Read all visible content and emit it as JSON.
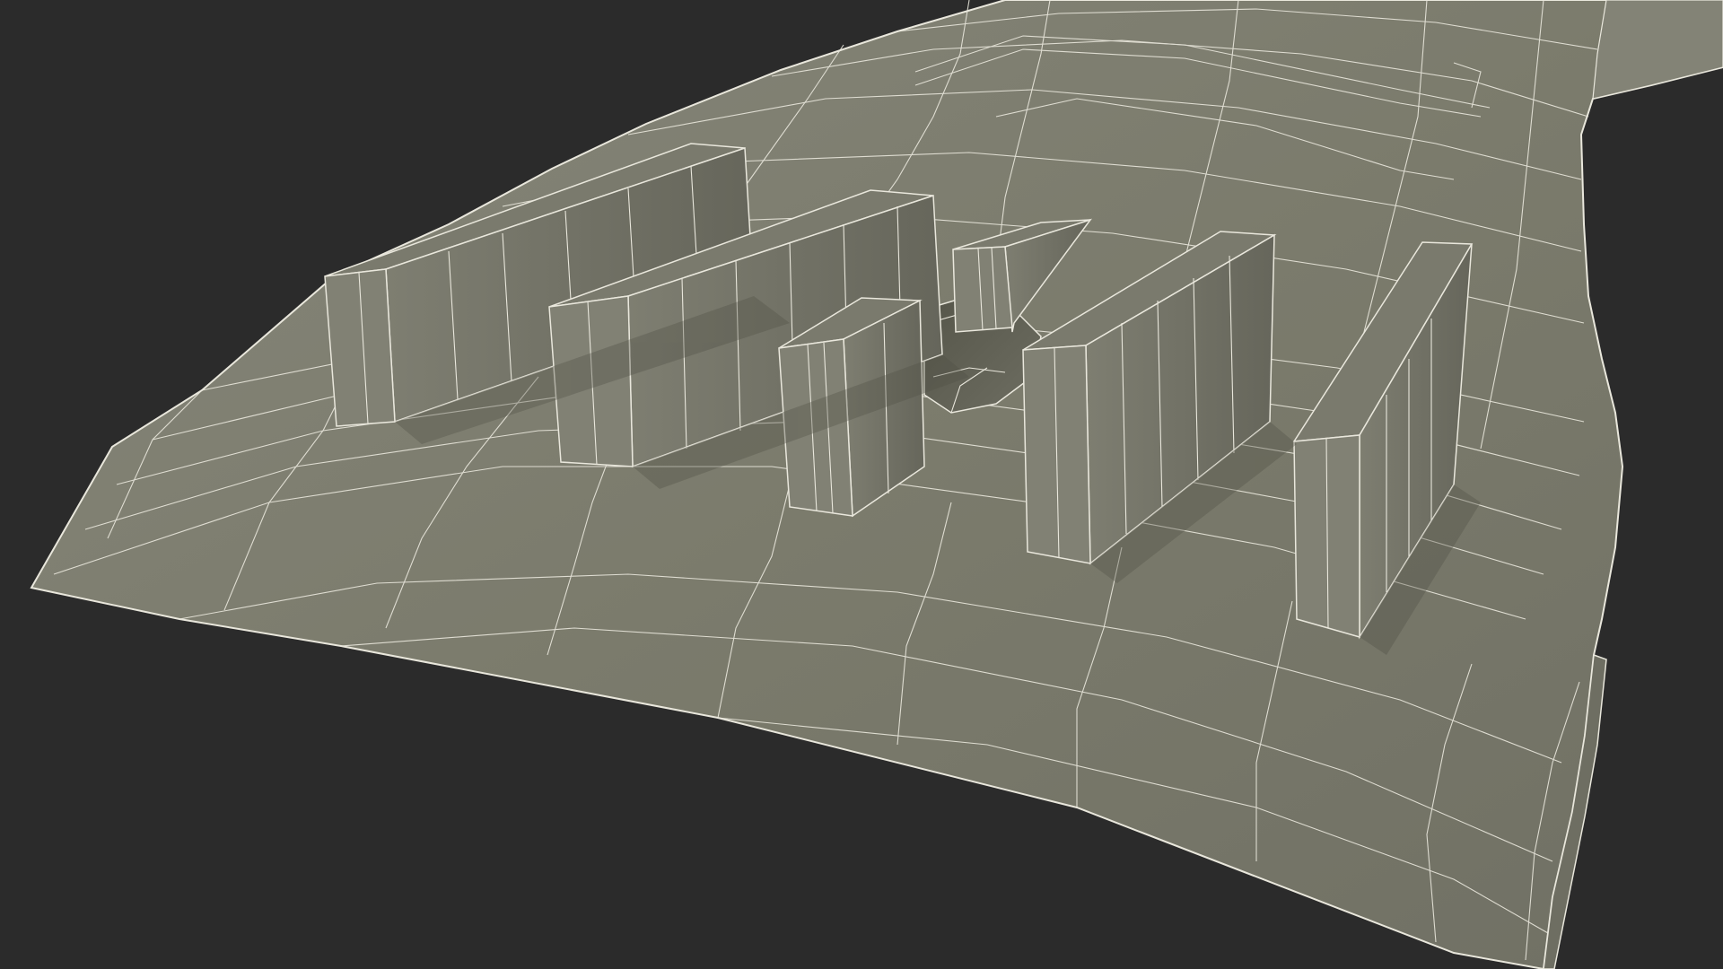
{
  "scene": {
    "subject": "wireframe-mesh-render",
    "colors": {
      "background": "#2b2b2b",
      "surface": "#7b7b6c",
      "surface_light": "#8a8a7a",
      "surface_shadow": "#5f5f53",
      "fin_side": "#6c6c5f",
      "fin_front": "#75756a",
      "wire": "#e9e7dc"
    }
  }
}
